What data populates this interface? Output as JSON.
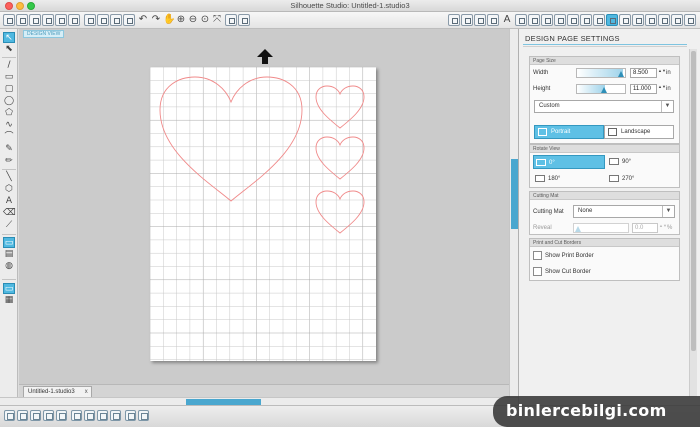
{
  "window": {
    "title": "Silhouette Studio: Untitled-1.studio3"
  },
  "canvas": {
    "view_label": "DESIGN VIEW",
    "document_tab": "Untitled-1.studio3",
    "tab_close": "x"
  },
  "panel": {
    "title": "DESIGN PAGE SETTINGS",
    "page_size": {
      "section": "Page Size",
      "width_label": "Width",
      "width_value": "8.500",
      "width_unit": "in",
      "height_label": "Height",
      "height_value": "11.000",
      "height_unit": "in",
      "preset": "Custom",
      "portrait": "Portrait",
      "landscape": "Landscape"
    },
    "rotate_view": {
      "section": "Rotate View",
      "r0": "0°",
      "r90": "90°",
      "r180": "180°",
      "r270": "270°"
    },
    "cutting_mat": {
      "section": "Cutting Mat",
      "label": "Cutting Mat",
      "value": "None",
      "reveal_label": "Reveal",
      "reveal_value": "0.0",
      "reveal_unit": "%"
    },
    "borders": {
      "section": "Print and Cut Borders",
      "print_border": "Show Print Border",
      "cut_border": "Show Cut Border"
    }
  },
  "watermark": "binlercebilgi.com",
  "colors": {
    "accent": "#4fb8e0",
    "heart_stroke": "#f08a8a",
    "grid_line": "#c9c9c9"
  }
}
